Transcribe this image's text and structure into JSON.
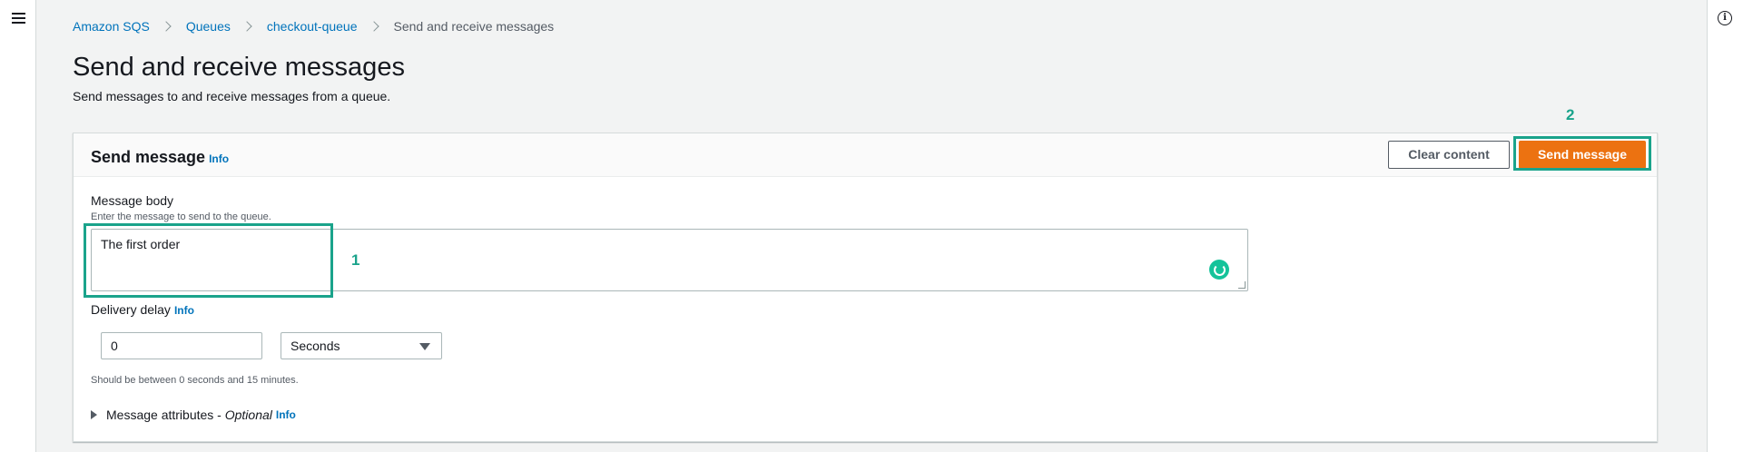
{
  "breadcrumb": {
    "items": [
      "Amazon SQS",
      "Queues",
      "checkout-queue"
    ],
    "current": "Send and receive messages"
  },
  "page": {
    "title": "Send and receive messages",
    "subtitle": "Send messages to and receive messages from a queue."
  },
  "send_panel": {
    "title": "Send message",
    "info": "Info",
    "clear_button": "Clear content",
    "send_button": "Send message",
    "message_body": {
      "label": "Message body",
      "description": "Enter the message to send to the queue.",
      "value": "The first order"
    },
    "delivery_delay": {
      "label": "Delivery delay",
      "info": "Info",
      "value": "0",
      "unit": "Seconds",
      "constraint": "Should be between 0 seconds and 15 minutes."
    },
    "attributes": {
      "label": "Message attributes - ",
      "optional": "Optional",
      "info": "Info"
    }
  },
  "annotations": {
    "step1": "1",
    "step2": "2",
    "color": "#1aa38b"
  },
  "colors": {
    "accent": "#ec7211",
    "link": "#0073bb"
  },
  "icons": [
    "menu-icon",
    "info-icon",
    "chevron-right-icon",
    "caret-down-icon",
    "caret-right-icon",
    "grammarly-icon"
  ]
}
